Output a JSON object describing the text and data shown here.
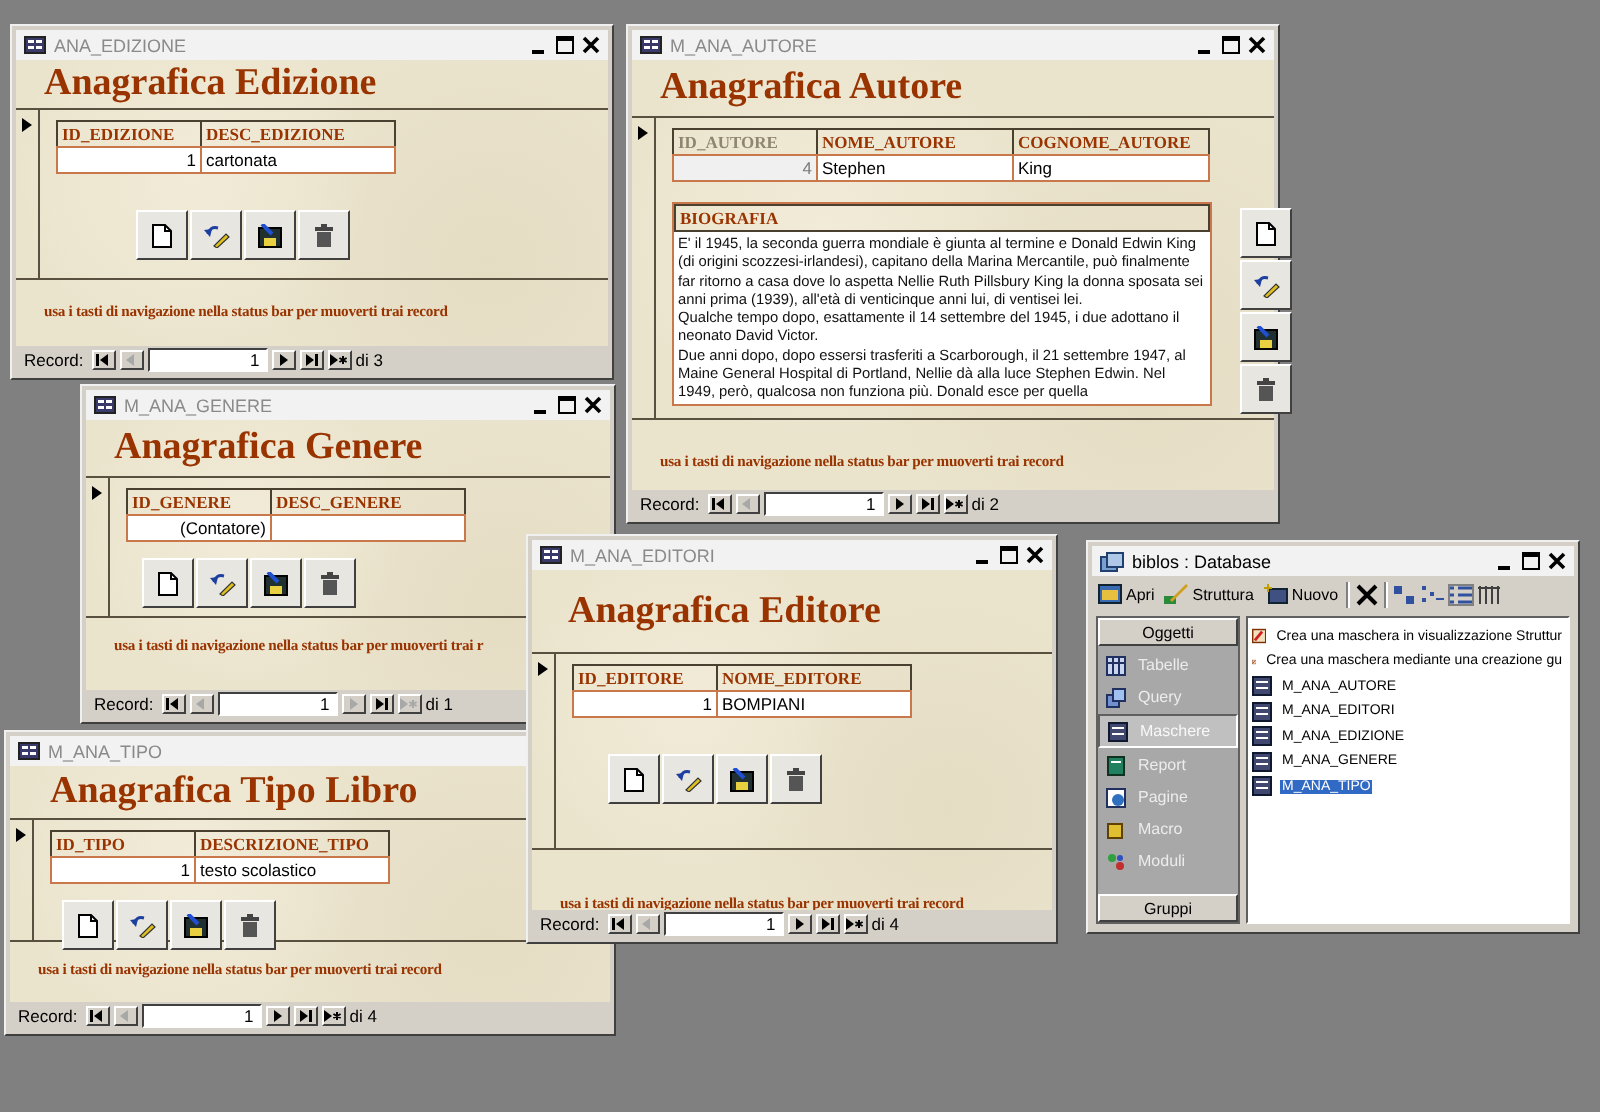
{
  "forms": [
    {
      "title": "ANA_EDIZIONE",
      "controls": true,
      "kind": "simple",
      "heading": "Anagrafica Edizione",
      "columns": [
        {
          "label": "ID_EDIZIONE",
          "disabled": false
        },
        {
          "label": "DESC_EDIZIONE",
          "disabled": false
        }
      ],
      "cells": [
        "1",
        "cartonata"
      ],
      "hint": "usa i tasti di navigazione nella status bar per muoverti trai record",
      "nav": {
        "label": "Record:",
        "value": "1",
        "count": "di 3",
        "prev_disabled": true,
        "next_disabled": false
      }
    },
    {
      "title": "M_ANA_AUTORE",
      "controls": true,
      "kind": "memo",
      "heading": "Anagrafica Autore",
      "columns": [
        {
          "label": "ID_AUTORE",
          "disabled": true
        },
        {
          "label": "NOME_AUTORE",
          "disabled": false
        },
        {
          "label": "COGNOME_AUTORE",
          "disabled": false
        }
      ],
      "cells": [
        "4",
        "Stephen",
        "King"
      ],
      "memo": {
        "label": "BIOGRAFIA",
        "paragraphs": [
          "E' il 1945, la seconda guerra mondiale è giunta al termine e Donald Edwin King (di origini scozzesi-irlandesi), capitano della Marina Mercantile, può finalmente far ritorno a casa dove lo aspetta Nellie Ruth Pillsbury King la donna sposata sei anni prima (1939), all'età di venticinque anni lui, di ventisei lei.",
          "Qualche tempo dopo, esattamente il 14 settembre del 1945, i due adottano il neonato David Victor.",
          "Due anni dopo, dopo essersi trasferiti a Scarborough, il 21 settembre 1947, al Maine General Hospital di Portland, Nellie dà alla luce Stephen Edwin. Nel 1949, però, qualcosa non funziona più. Donald esce per quella"
        ]
      },
      "hint": "usa i tasti di navigazione nella status bar per muoverti trai record",
      "nav": {
        "label": "Record:",
        "value": "1",
        "count": "di 2",
        "prev_disabled": true,
        "next_disabled": false
      }
    },
    {
      "title": "M_ANA_GENERE",
      "controls": true,
      "kind": "simple",
      "heading": "Anagrafica Genere",
      "columns": [
        {
          "label": "ID_GENERE",
          "disabled": false
        },
        {
          "label": "DESC_GENERE",
          "disabled": false
        }
      ],
      "cells": [
        "(Contatore)"
      ],
      "hint": "usa i tasti di navigazione nella status bar per muoverti trai r",
      "nav": {
        "label": "Record:",
        "value": "1",
        "count": "di 1",
        "prev_disabled": true,
        "next_disabled": true
      }
    },
    {
      "title": "M_ANA_EDITORI",
      "controls": true,
      "kind": "simple",
      "heading": "Anagrafica Editore",
      "columns": [
        {
          "label": "ID_EDITORE",
          "disabled": false
        },
        {
          "label": "NOME_EDITORE",
          "disabled": false
        }
      ],
      "cells": [
        "1",
        "BOMPIANI"
      ],
      "hint": "usa i tasti di navigazione nella status bar per muoverti trai record",
      "nav": {
        "label": "Record:",
        "value": "1",
        "count": "di 4",
        "prev_disabled": true,
        "next_disabled": false
      }
    },
    {
      "title": "M_ANA_TIPO",
      "controls": false,
      "kind": "simple",
      "heading": "Anagrafica Tipo Libro",
      "columns": [
        {
          "label": "ID_TIPO",
          "disabled": false
        },
        {
          "label": "DESCRIZIONE_TIPO",
          "disabled": false
        }
      ],
      "cells": [
        "1",
        "testo scolastico"
      ],
      "hint": "usa i tasti di navigazione nella status bar per muoverti trai record",
      "nav": {
        "label": "Record:",
        "value": "1",
        "count": "di 4",
        "prev_disabled": true,
        "next_disabled": false
      }
    }
  ],
  "database": {
    "title": "biblos : Database",
    "toolbar": [
      "Apri",
      "Struttura",
      "Nuovo"
    ],
    "groups_header": "Oggetti",
    "objects": [
      {
        "label": "Tabelle",
        "selected": false
      },
      {
        "label": "Query",
        "selected": false
      },
      {
        "label": "Maschere",
        "selected": true
      },
      {
        "label": "Report",
        "selected": false
      },
      {
        "label": "Pagine",
        "selected": false
      },
      {
        "label": "Macro",
        "selected": false
      },
      {
        "label": "Moduli",
        "selected": false
      }
    ],
    "groups_footer": "Gruppi",
    "items": [
      {
        "kind": "wizard",
        "label": "Crea una maschera in visualizzazione Struttur",
        "selected": false
      },
      {
        "kind": "wizard",
        "label": "Crea una maschera mediante una creazione gu",
        "selected": false
      },
      {
        "kind": "form",
        "label": "M_ANA_AUTORE",
        "selected": false
      },
      {
        "kind": "form",
        "label": "M_ANA_EDITORI",
        "selected": false
      },
      {
        "kind": "form",
        "label": "M_ANA_EDIZIONE",
        "selected": false
      },
      {
        "kind": "form",
        "label": "M_ANA_GENERE",
        "selected": false
      },
      {
        "kind": "form",
        "label": "M_ANA_TIPO",
        "selected": true
      }
    ]
  }
}
